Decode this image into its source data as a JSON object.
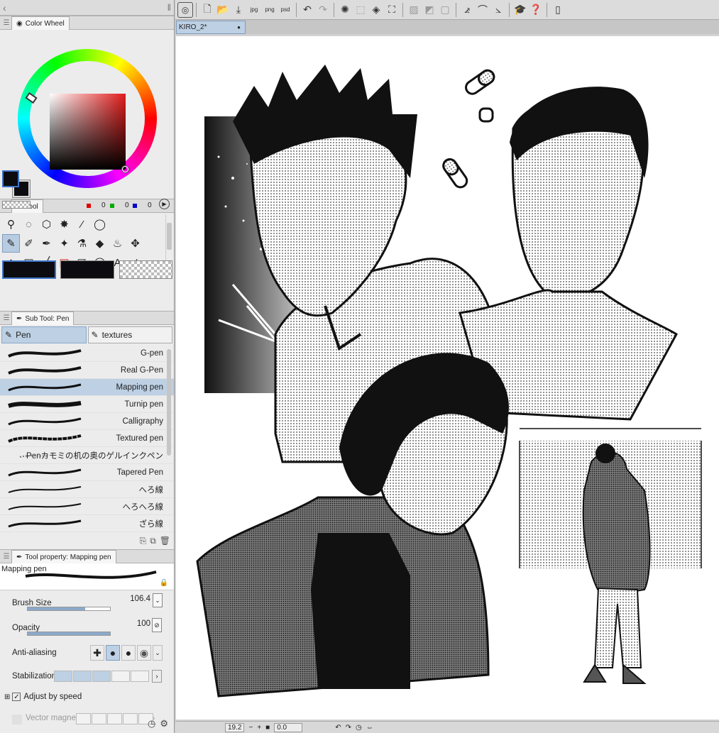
{
  "left_toolbar": {
    "collapse_icon": "chevron-left"
  },
  "color_wheel": {
    "title": "Color Wheel",
    "main_color": "#0c0c10",
    "sub_color": "#0c0c10",
    "hue_color": "#e21b1b",
    "r": "0",
    "g": "0",
    "b": "0"
  },
  "tool_panel": {
    "title": "Tool",
    "tools": [
      "zoom-icon",
      "move-icon",
      "object-icon",
      "auto-select-icon",
      "eyedropper-icon",
      "lasso-icon",
      "pen-icon",
      "pencil-icon",
      "brush-icon",
      "airbrush-icon",
      "decoration-icon",
      "eraser-icon",
      "blend-icon",
      "move-layer-icon",
      "fill-icon",
      "gradient-icon",
      "line-icon",
      "frame-icon",
      "ruler-icon",
      "balloon-icon",
      "text-icon",
      "correct-line-icon"
    ],
    "selected_tool": "pen-icon"
  },
  "sub_tool": {
    "title": "Sub Tool: Pen",
    "tabs": [
      "Pen",
      "textures"
    ],
    "active_tab": "Pen",
    "brushes": [
      "G-pen",
      "Real G-Pen",
      "Mapping pen",
      "Turnip pen",
      "Calligraphy",
      "Textured pen",
      "Penカモミの机の奥のゲルインクペン",
      "Tapered Pen",
      "へろ線",
      "へろへろ線",
      "ざら線"
    ],
    "selected": "Mapping pen"
  },
  "tool_property": {
    "title": "Tool property: Mapping pen",
    "preview_label": "Mapping pen",
    "brush_size_label": "Brush Size",
    "brush_size": "106.4",
    "brush_size_fraction": 0.7,
    "opacity_label": "Opacity",
    "opacity": "100",
    "opacity_fraction": 1.0,
    "anti_aliasing_label": "Anti-aliasing",
    "stabilization_label": "Stabilization",
    "stabilization_level": 3,
    "adjust_label": "Adjust by speed",
    "vector_label": "Vector magnet"
  },
  "document": {
    "tab": "KIRO_2*",
    "modified_dot": "●"
  },
  "status": {
    "zoom": "19.2",
    "rotation": "0.0"
  },
  "accent": "#bdd0e4"
}
